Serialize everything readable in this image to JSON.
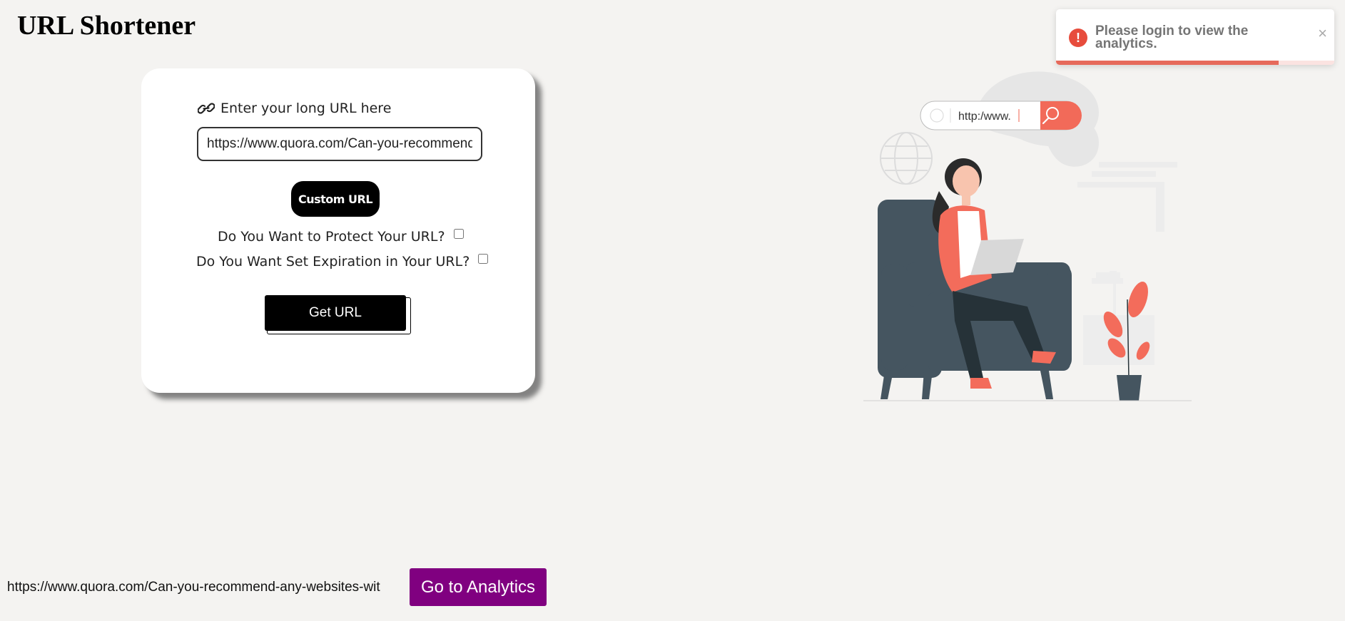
{
  "page": {
    "title": "URL Shortener"
  },
  "form": {
    "url_label": "Enter your long URL here",
    "url_value": "https://www.quora.com/Can-you-recommend-any-websites-with-free-APIs",
    "custom_url_label": "Custom URL",
    "protect_label": "Do You Want to Protect Your URL?",
    "protect_checked": false,
    "expiration_label": "Do You Want Set Expiration in Your URL?",
    "expiration_checked": false,
    "get_url_label": "Get URL"
  },
  "illustration": {
    "search_text": "http:/www."
  },
  "toast": {
    "message": "Please login to view the analytics.",
    "close_label": "×",
    "progress_fraction": 0.8,
    "icon": "error-icon",
    "accent_color": "#e74c3c"
  },
  "result": {
    "short_url_text": "https://www.quora.com/Can-you-recommend-any-websites-wit",
    "analytics_button_label": "Go to Analytics",
    "analytics_button_color": "#800080"
  }
}
